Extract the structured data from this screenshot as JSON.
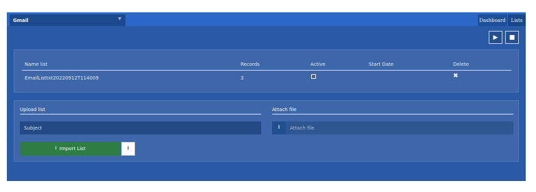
{
  "header": {
    "account_select": "Gmail",
    "tabs": [
      "Dashboard",
      "Lists"
    ]
  },
  "lists_table": {
    "columns": [
      "Name list",
      "Records",
      "Active",
      "Start Date",
      "Delete"
    ],
    "rows": [
      {
        "name": "EmailListtxt20220912T114009",
        "records": "3",
        "active": false,
        "start_date": ""
      }
    ]
  },
  "upload": {
    "upload_label": "Upload list",
    "attach_label": "Attach file",
    "subject_value": "Subject",
    "attach_placeholder": "Attach file",
    "import_button": "Import List"
  },
  "icons": {
    "play": "play-icon",
    "stop": "stop-icon",
    "delete": "times-icon",
    "upload": "upload-icon",
    "download": "download-icon",
    "caret": "chevron-down-icon"
  },
  "colors": {
    "page_bg": "#2a5aa6",
    "topbar": "#2c68c8",
    "panel": "#3d67a8",
    "import_button": "#2e7d45"
  }
}
